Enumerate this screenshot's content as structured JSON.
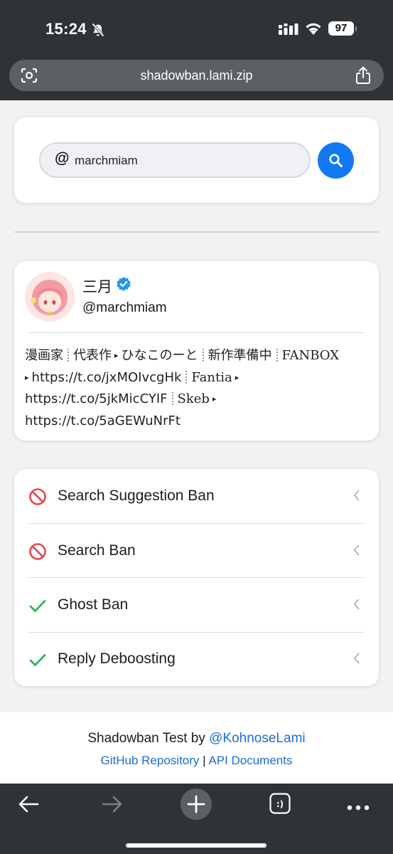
{
  "status": {
    "time": "15:24",
    "battery": "97"
  },
  "browser": {
    "url": "shadowban.lami.zip"
  },
  "search": {
    "at": "@",
    "value": "marchmiam"
  },
  "profile": {
    "name": "三月",
    "handle": "@marchmiam",
    "bio": {
      "l1a": "漫画家",
      "l1b": "代表作",
      "l1c": "ひなこのーと",
      "l1d": "新作準備中",
      "l1e": "FANBOX",
      "l2a": "https://t.co/jxMOIvcgHk",
      "l2b": "Fantia",
      "l3a": "https://t.co/5jkMicCYIF",
      "l3b": "Skeb",
      "l4a": "https://t.co/5aGEWuNrFt"
    }
  },
  "results": [
    {
      "label": "Search Suggestion Ban",
      "status": "banned",
      "color": "#e5484d"
    },
    {
      "label": "Search Ban",
      "status": "banned",
      "color": "#e5484d"
    },
    {
      "label": "Ghost Ban",
      "status": "ok",
      "color": "#2fb55c"
    },
    {
      "label": "Reply Deboosting",
      "status": "ok",
      "color": "#2fb55c"
    }
  ],
  "footer": {
    "prefix": "Shadowban Test by ",
    "author": "@KohnoseLami",
    "github": "GitHub Repository",
    "divider": "|",
    "api": "API Documents"
  },
  "colors": {
    "accent": "#1279f2",
    "link": "#1a6ed8"
  }
}
